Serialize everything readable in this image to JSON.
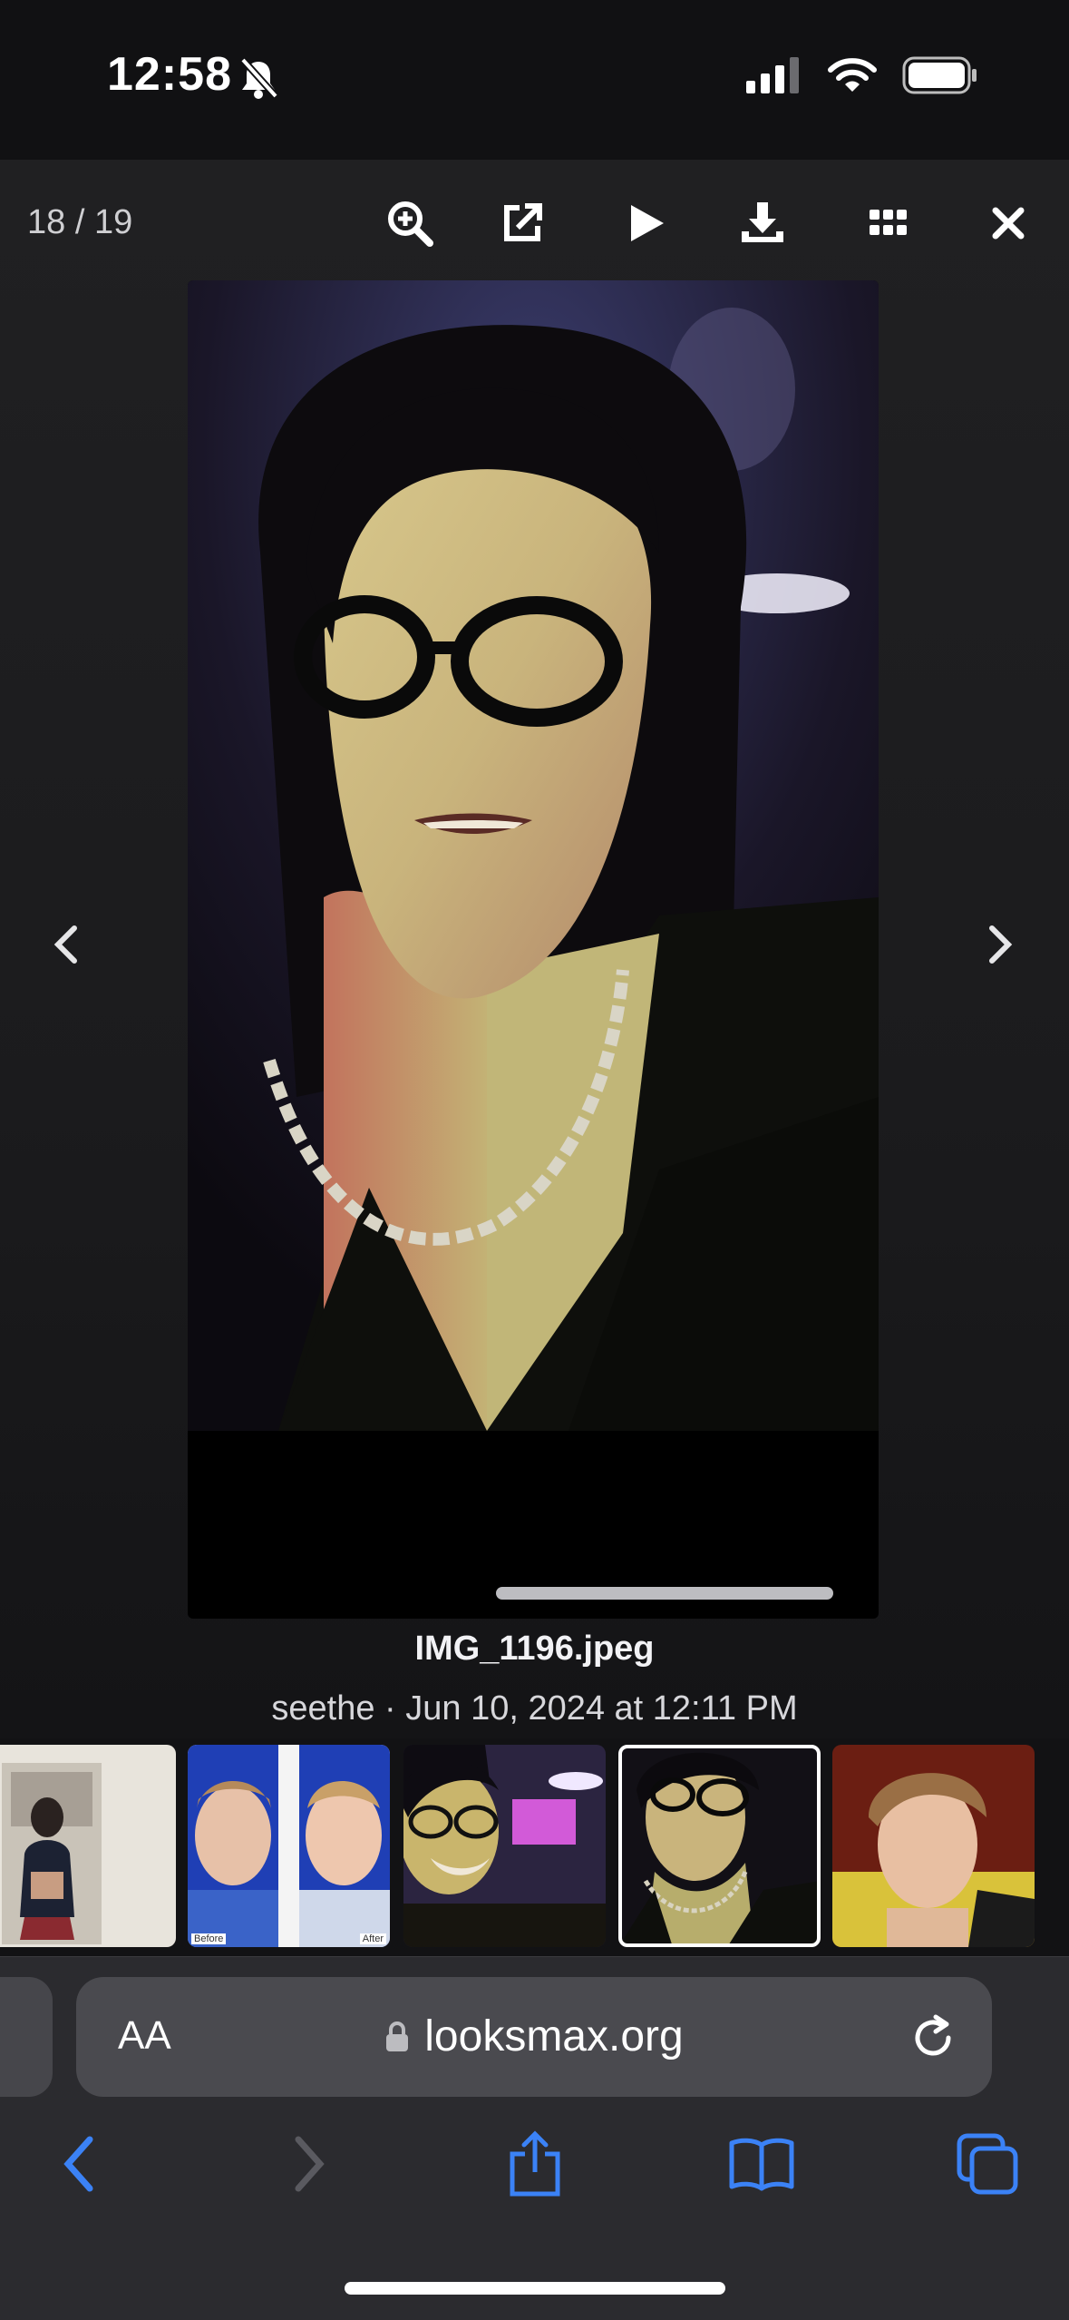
{
  "status_bar": {
    "time": "12:58",
    "icons": [
      "bell-slash-icon",
      "cellular-signal-icon",
      "wifi-icon",
      "battery-icon"
    ]
  },
  "lightbox": {
    "counter": "18 / 19",
    "toolbar_icons": [
      "zoom-in-icon",
      "open-external-icon",
      "play-icon",
      "download-icon",
      "grid-icon",
      "close-icon"
    ],
    "image": {
      "filename": "IMG_1196.jpeg",
      "meta": "seethe · Jun 10, 2024 at 12:11 PM"
    },
    "thumbnail_count": 5,
    "active_thumbnail": 4
  },
  "thumbnails": [
    {
      "name": "thumb-mirror-selfie",
      "labels": []
    },
    {
      "name": "thumb-before-after",
      "labels": [
        "Before",
        "After"
      ]
    },
    {
      "name": "thumb-party-selfie",
      "labels": []
    },
    {
      "name": "thumb-current",
      "labels": []
    },
    {
      "name": "thumb-portrait",
      "labels": []
    }
  ],
  "browser": {
    "text_size_label": "AA",
    "url": "looksmax.org",
    "accent_color": "#3b82f6",
    "nav_icons": [
      "back-icon",
      "forward-icon",
      "share-icon",
      "bookmarks-icon",
      "tabs-icon"
    ]
  }
}
